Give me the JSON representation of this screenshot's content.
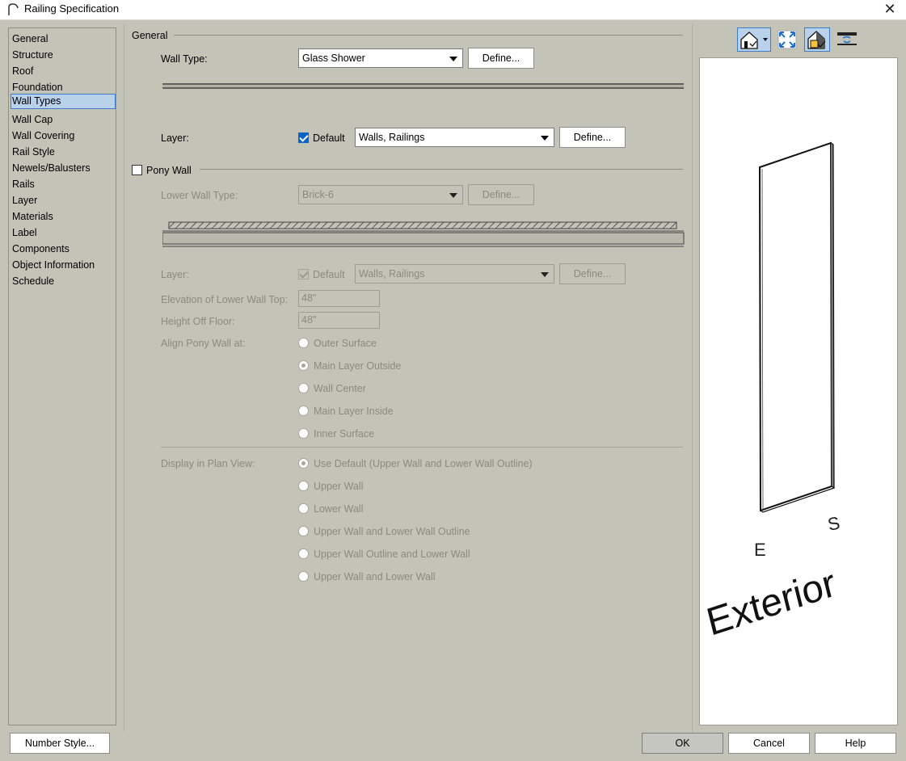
{
  "window": {
    "title": "Railing Specification"
  },
  "nav": {
    "items": [
      "General",
      "Structure",
      "Roof",
      "Foundation",
      "Wall Types",
      "Wall Cap",
      "Wall Covering",
      "Rail Style",
      "Newels/Balusters",
      "Rails",
      "Layer",
      "Materials",
      "Label",
      "Components",
      "Object Information",
      "Schedule"
    ],
    "selected": "Wall Types"
  },
  "general": {
    "heading": "General",
    "wall_type_label": "Wall Type:",
    "wall_type_value": "Glass Shower",
    "define_label": "Define...",
    "layer_label": "Layer:",
    "default_label": "Default",
    "default_checked": true,
    "layer_value": "Walls,  Railings"
  },
  "pony": {
    "heading": "Pony Wall",
    "checked": false,
    "lower_wall_type_label": "Lower Wall Type:",
    "lower_wall_type_value": "Brick-6",
    "define_label": "Define...",
    "layer_label": "Layer:",
    "default_label": "Default",
    "layer_value": "Walls,  Railings",
    "elevation_label": "Elevation of Lower Wall Top:",
    "elevation_value": "48\"",
    "height_label": "Height Off Floor:",
    "height_value": "48\"",
    "align_label": "Align Pony Wall at:",
    "align_options": [
      "Outer Surface",
      "Main Layer Outside",
      "Wall Center",
      "Main Layer Inside",
      "Inner Surface"
    ],
    "align_selected": "Main Layer Outside",
    "display_label": "Display in Plan View:",
    "display_options": [
      "Use Default (Upper Wall and Lower Wall Outline)",
      "Upper Wall",
      "Lower Wall",
      "Upper Wall and Lower Wall Outline",
      "Upper Wall Outline and Lower Wall",
      "Upper Wall and Lower Wall"
    ],
    "display_selected": "Use Default (Upper Wall and Lower Wall Outline)"
  },
  "preview": {
    "labels": {
      "e": "E",
      "s": "S",
      "exterior": "Exterior"
    },
    "tools": [
      "camera-view-icon",
      "fill-window-icon",
      "render-mode-icon",
      "swap-icon"
    ]
  },
  "footer": {
    "number_style": "Number Style...",
    "ok": "OK",
    "cancel": "Cancel",
    "help": "Help"
  }
}
